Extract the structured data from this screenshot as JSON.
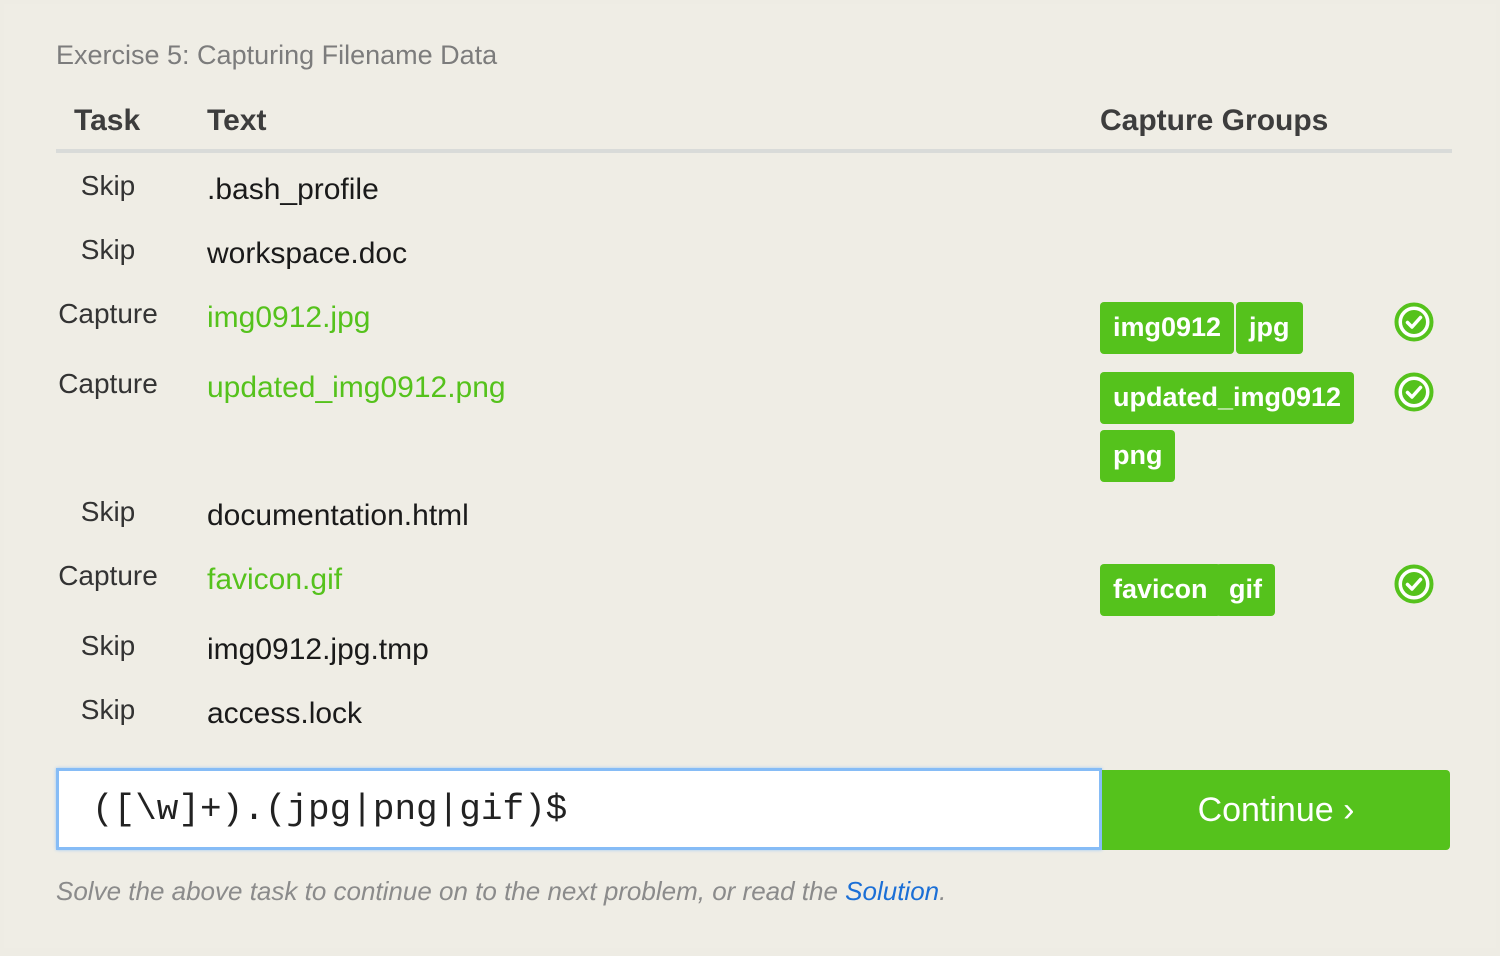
{
  "exercise_title": "Exercise 5: Capturing Filename Data",
  "columns": {
    "task": "Task",
    "text": "Text",
    "groups": "Capture Groups"
  },
  "rows": [
    {
      "task": "Skip",
      "text": ".bash_profile",
      "groups": [],
      "matched": false
    },
    {
      "task": "Skip",
      "text": "workspace.doc",
      "groups": [],
      "matched": false
    },
    {
      "task": "Capture",
      "text": "img0912.jpg",
      "groups": [
        "img0912",
        "jpg"
      ],
      "matched": true
    },
    {
      "task": "Capture",
      "text": "updated_img0912.png",
      "groups": [
        "updated_img0912",
        "png"
      ],
      "matched": true
    },
    {
      "task": "Skip",
      "text": "documentation.html",
      "groups": [],
      "matched": false
    },
    {
      "task": "Capture",
      "text": "favicon.gif",
      "groups": [
        "favicon",
        "gif"
      ],
      "matched": true
    },
    {
      "task": "Skip",
      "text": "img0912.jpg.tmp",
      "groups": [],
      "matched": false
    },
    {
      "task": "Skip",
      "text": "access.lock",
      "groups": [],
      "matched": false
    }
  ],
  "regex_input": {
    "value": "([\\w]+).(jpg|png|gif)$"
  },
  "continue_button": {
    "label": "Continue ›"
  },
  "footer": {
    "text": "Solve the above task to continue on to the next problem, or read the ",
    "link": "Solution",
    "suffix": "."
  },
  "colors": {
    "accent": "#55c21c",
    "link": "#1b6fd6",
    "background": "#efede5"
  },
  "icons": {
    "match": "check-circle-icon"
  }
}
